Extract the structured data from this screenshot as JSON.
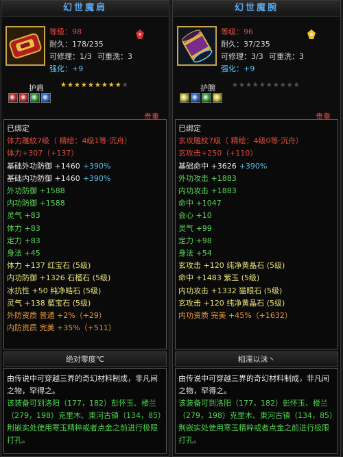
{
  "left": {
    "title": "幻世魔肩",
    "level": "等級：98",
    "durability": "耐久：178/235",
    "repairable": "可修理：1/3",
    "reset": "可重洗：3",
    "enhance": "强化：+9",
    "slot": "护肩",
    "stars_on": 9,
    "stars_total": 10,
    "gem_colors": [
      "#c03030",
      "#c03030",
      "#30a040",
      "#3070d0"
    ],
    "badge": "贵重",
    "attrs": [
      {
        "text": "已绑定",
        "color": "white"
      },
      {
        "text": "体力雕紋7级（ 精绘：4级1等·沉舟）",
        "color": "red"
      },
      {
        "text": "体力+307（+137）",
        "color": "red"
      },
      {
        "text": "基础外功防御 +1460",
        "extra": "+390%",
        "color": "white"
      },
      {
        "text": "基础内功防御 +1460",
        "extra": "+390%",
        "color": "white"
      },
      {
        "text": "外功防御 +1588",
        "color": "green"
      },
      {
        "text": "内功防御 +1588",
        "color": "green"
      },
      {
        "text": "灵气 +83",
        "color": "green"
      },
      {
        "text": "体力 +83",
        "color": "green"
      },
      {
        "text": "定力 +83",
        "color": "green"
      },
      {
        "text": "身法 +45",
        "color": "green"
      },
      {
        "text": "体力 +137 红宝石 (5级)",
        "color": "yellow"
      },
      {
        "text": "内功防御 +1326 石榴石 (5级)",
        "color": "yellow"
      },
      {
        "text": "冰抗性 +50 纯净皓石 (5级)",
        "color": "yellow"
      },
      {
        "text": "灵气 +138 藍宝石 (5级)",
        "color": "yellow"
      },
      {
        "text": "外防资质  普通 +2%（+29）",
        "color": "orange"
      },
      {
        "text": "内防资质  完美 +35%（+511）",
        "color": "orange"
      }
    ],
    "footer": "绝对零度℃",
    "desc_white": "由传说中可穿越三界的奇幻材料制成，非凡间之物，罕得之。",
    "desc_green": "该装备可到洛阳（177，182）彭怀玉、楼兰（279，198）克里木、東河古镇（134，85）荆嵌实处使用寒玉精粹或者点金之前进行极限打孔。"
  },
  "right": {
    "title": "幻世魔腕",
    "level": "等级：96",
    "durability": "耐久：37/235",
    "repairable": "可修理：3/3",
    "reset": "可重洗：3",
    "enhance": "强化：+9",
    "slot": "护腕",
    "stars_on": 0,
    "stars_total": 10,
    "gem_colors": [
      "#c8c030",
      "#3070d0",
      "#40a040",
      "#c8c030"
    ],
    "badge": "贵重",
    "attrs": [
      {
        "text": "已绑定",
        "color": "white"
      },
      {
        "text": "玄攻雕紋7级（ 精绘：4级0等·沉舟）",
        "color": "red"
      },
      {
        "text": "玄攻击+250（+110）",
        "color": "red"
      },
      {
        "text": "基础命中 +3626",
        "extra": "+390%",
        "color": "white"
      },
      {
        "text": "外功攻击 +1883",
        "color": "green"
      },
      {
        "text": "内功攻击 +1883",
        "color": "green"
      },
      {
        "text": "命中 +1047",
        "color": "green"
      },
      {
        "text": "会心 +10",
        "color": "green"
      },
      {
        "text": "灵气 +99",
        "color": "green"
      },
      {
        "text": "定力 +98",
        "color": "green"
      },
      {
        "text": "身法 +54",
        "color": "green"
      },
      {
        "text": "玄攻击 +120 纯净黄晶石 (5级)",
        "color": "yellow"
      },
      {
        "text": "命中 +1483 紫玉 (5级)",
        "color": "yellow"
      },
      {
        "text": "内功攻击 +1332 猫眼石 (5级)",
        "color": "yellow"
      },
      {
        "text": "玄攻击 +120 纯净黄晶石 (5级)",
        "color": "yellow"
      },
      {
        "text": "内功资质  完美 +45%（+1632）",
        "color": "orange"
      }
    ],
    "footer": "相濡以沫丶",
    "desc_white": "由传说中可穿越三界的奇幻材料制成，非凡间之物，罕得之。",
    "desc_green": "该装备可到洛阳（177，182）彭怀玉、楼兰（279，198）克里木、東河古镇（134，85）荆嵌实处使用寒玉精粹或者点金之前进行极限打孔。"
  }
}
